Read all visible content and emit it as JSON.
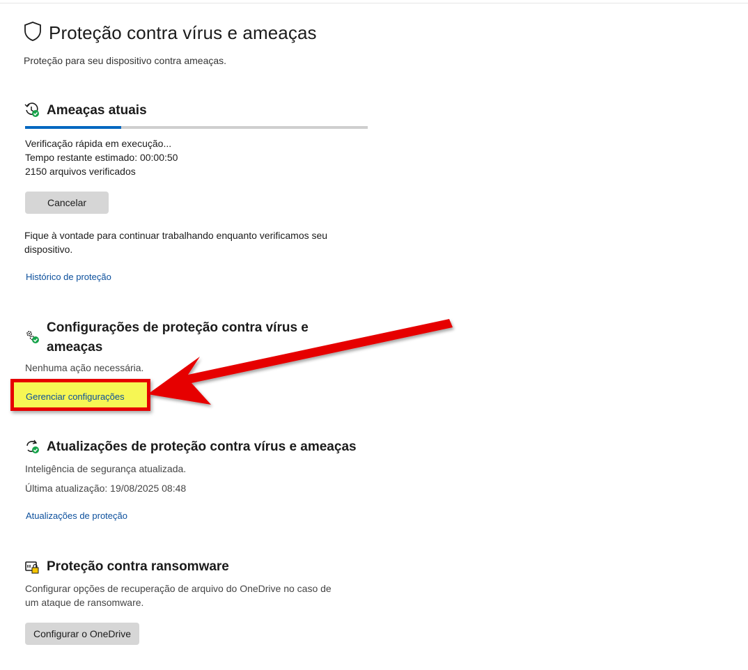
{
  "header": {
    "title": "Proteção contra vírus e ameaças",
    "subtitle": "Proteção para seu dispositivo contra ameaças."
  },
  "current_threats": {
    "title": "Ameaças atuais",
    "progress_fraction": 0.28,
    "status_lines": [
      "Verificação rápida em execução...",
      "Tempo restante estimado: 00:00:50",
      "2150 arquivos verificados"
    ],
    "cancel_label": "Cancelar",
    "info_text": "Fique à vontade para continuar trabalhando enquanto verificamos seu dispositivo.",
    "history_link": "Histórico de proteção"
  },
  "settings": {
    "title_line1": "Configurações de proteção contra vírus e",
    "title_line2": "ameaças",
    "status": "Nenhuma ação necessária.",
    "manage_link": "Gerenciar configurações"
  },
  "updates": {
    "title": "Atualizações de proteção contra vírus e ameaças",
    "status": "Inteligência de segurança atualizada.",
    "last_update": "Última atualização: 19/08/2025 08:48",
    "updates_link": "Atualizações de proteção"
  },
  "ransomware": {
    "title": "Proteção contra ransomware",
    "description_line1": "Configurar opções de recuperação de arquivo do OneDrive no caso de",
    "description_line2": "um ataque de ransomware.",
    "onedrive_button": "Configurar o OneDrive"
  },
  "icons": {
    "page": "shield-icon",
    "threats": "history-check-icon",
    "settings": "gears-check-icon",
    "updates": "refresh-check-icon",
    "ransomware": "ransomware-icon"
  },
  "colors": {
    "accent": "#0067c0",
    "link": "#0b4f9c",
    "annotation_red": "#e60000",
    "annotation_yellow": "#f6f654",
    "ok_green": "#16a34a"
  }
}
